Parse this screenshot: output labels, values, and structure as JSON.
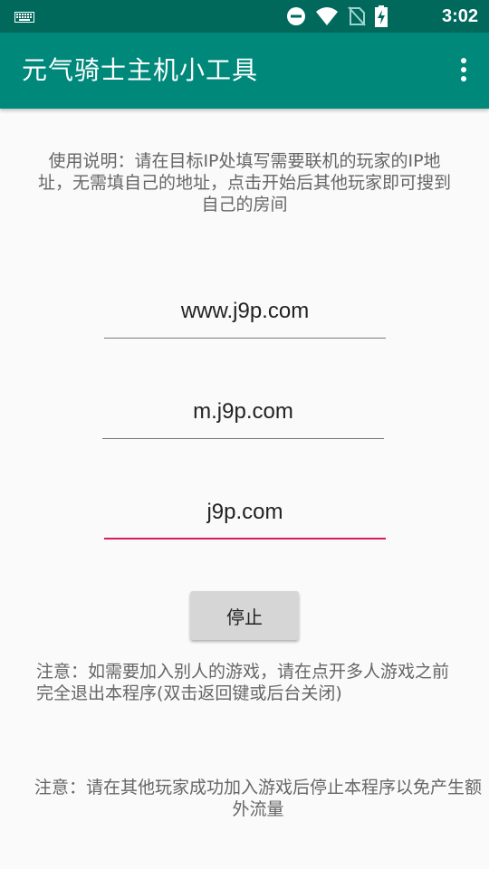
{
  "status_bar": {
    "time": "3:02",
    "icons": [
      "keyboard-icon",
      "do-not-disturb-icon",
      "wifi-icon",
      "no-sim-icon",
      "battery-charging-icon"
    ]
  },
  "app_bar": {
    "title": "元气骑士主机小工具",
    "overflow_icon": "more-vert-icon"
  },
  "instructions": "使用说明：请在目标IP处填写需要联机的玩家的IP地址，无需填自己的地址，点击开始后其他玩家即可搜到自己的房间",
  "fields": [
    {
      "value": "www.j9p.com",
      "focused": false
    },
    {
      "value": "m.j9p.com",
      "focused": false
    },
    {
      "value": "j9p.com",
      "focused": true
    }
  ],
  "stop_button_label": "停止",
  "note1": "注意：如需要加入别人的游戏，请在点开多人游戏之前完全退出本程序(双击返回键或后台关闭)",
  "note2": "注意：请在其他玩家成功加入游戏后停止本程序以免产生额外流量",
  "colors": {
    "status_bar": "#00695c",
    "app_bar": "#00897b",
    "accent": "#d81b60",
    "button": "#d6d6d6"
  }
}
